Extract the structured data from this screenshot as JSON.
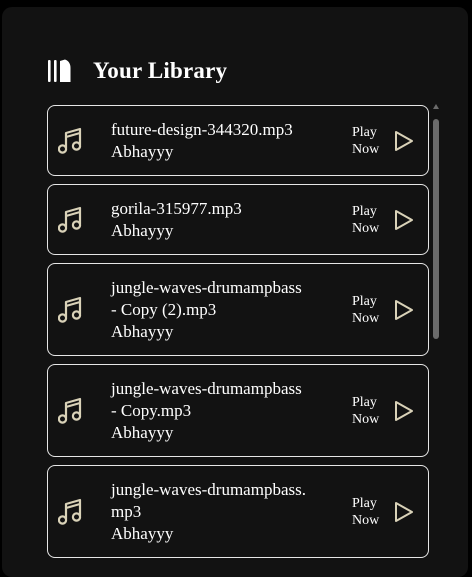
{
  "library": {
    "title": "Your Library",
    "icon": "library-icon"
  },
  "tracks": [
    {
      "lines": [
        "future-design-344320.mp3"
      ],
      "artist": "Abhayyy",
      "action": [
        "Play",
        "Now"
      ]
    },
    {
      "lines": [
        "gorila-315977.mp3"
      ],
      "artist": "Abhayyy",
      "action": [
        "Play",
        "Now"
      ]
    },
    {
      "lines": [
        "jungle-waves-drumampbass",
        "- Copy (2).mp3"
      ],
      "artist": "Abhayyy",
      "action": [
        "Play",
        "Now"
      ]
    },
    {
      "lines": [
        "jungle-waves-drumampbass",
        "- Copy.mp3"
      ],
      "artist": "Abhayyy",
      "action": [
        "Play",
        "Now"
      ]
    },
    {
      "lines": [
        "jungle-waves-drumampbass.",
        "mp3"
      ],
      "artist": "Abhayyy",
      "action": [
        "Play",
        "Now"
      ]
    }
  ],
  "icons": {
    "track": "music-note-icon",
    "play": "play-icon"
  },
  "colors": {
    "background": "#000000",
    "panel": "#121212",
    "card_border": "#e6e6e6",
    "icon": "#d9d2b8",
    "text": "#ffffff"
  }
}
